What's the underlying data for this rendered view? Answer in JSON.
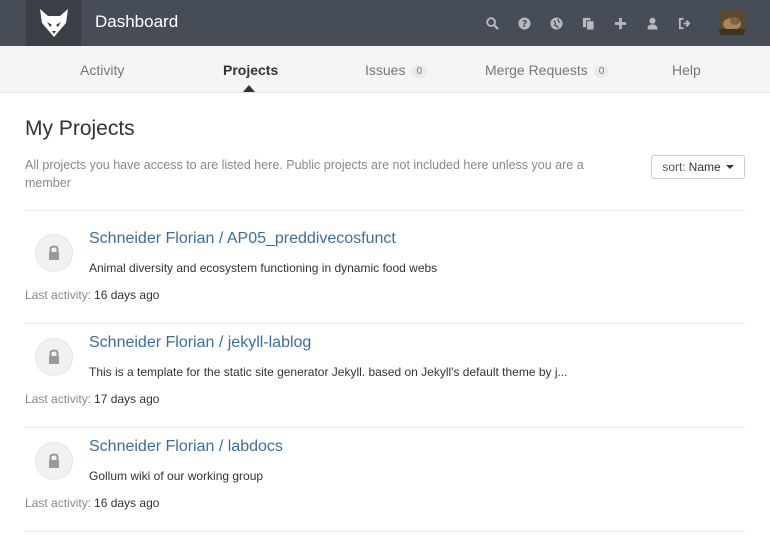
{
  "header": {
    "title": "Dashboard",
    "icons": [
      "search-icon",
      "help-icon",
      "globe-icon",
      "snippets-icon",
      "plus-icon",
      "profile-icon",
      "logout-icon"
    ]
  },
  "nav": {
    "tabs": [
      {
        "label": "Activity"
      },
      {
        "label": "Projects",
        "active": true
      },
      {
        "label": "Issues",
        "count": "0"
      },
      {
        "label": "Merge Requests",
        "count": "0"
      },
      {
        "label": "Help"
      }
    ]
  },
  "main": {
    "title": "My Projects",
    "description": "All projects you have access to are listed here. Public projects are not included here unless you are a member",
    "sort": {
      "prefix": "sort:",
      "value": "Name"
    },
    "activity_label": "Last activity:",
    "projects": [
      {
        "title": "Schneider Florian / AP05_preddivecosfunct",
        "description": "Animal diversity and ecosystem functioning in dynamic food webs",
        "last_activity": "16 days ago"
      },
      {
        "title": "Schneider Florian / jekyll-lablog",
        "description": "This is a template for the static site generator Jekyll. based on Jekyll's default theme by j...",
        "last_activity": "17 days ago"
      },
      {
        "title": "Schneider Florian / labdocs",
        "description": "Gollum wiki of our working group",
        "last_activity": "16 days ago"
      }
    ]
  },
  "colors": {
    "header_bg": "#474d57",
    "link": "#3b6e9e"
  }
}
